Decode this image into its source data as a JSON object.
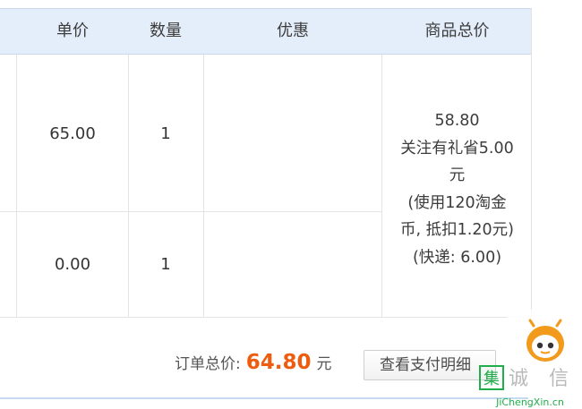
{
  "table": {
    "headers": {
      "unit_price": "单价",
      "quantity": "数量",
      "discount": "优惠",
      "subtotal": "商品总价"
    },
    "rows": [
      {
        "unit_price": "65.00",
        "quantity": "1"
      },
      {
        "unit_price": "0.00",
        "quantity": "1"
      }
    ],
    "subtotal_lines": [
      "58.80",
      "关注有礼省5.00",
      "元",
      "(使用120淘金",
      "币, 抵扣1.20元)",
      "(快递: 6.00)"
    ]
  },
  "summary": {
    "label": "订单总价:",
    "amount": "64.80",
    "unit": "元",
    "detail_button": "查看支付明细"
  },
  "watermark": {
    "pinyin": "JiChengXin.cn",
    "chars": "集诚信"
  },
  "colors": {
    "header_bg": "#e4eefb",
    "price_accent": "#ee5c10",
    "grid_line": "#e3e3e3",
    "watermark_green": "#1fae4a"
  }
}
